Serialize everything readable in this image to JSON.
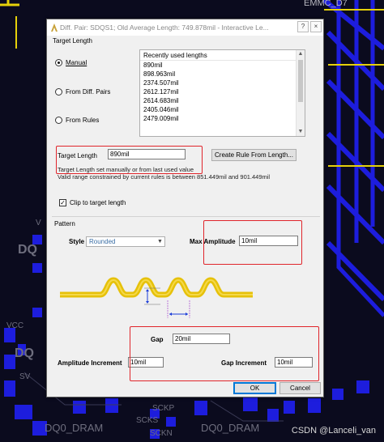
{
  "background": {
    "labels": {
      "top_right": "EMMC_D7",
      "dq_a": "DQ",
      "dq_b": "DQ",
      "dq_c": "DQ",
      "vcc": "VCC",
      "sv": "SV",
      "v": "V",
      "sckp": "SCKP",
      "scks": "SCKS",
      "sckn": "SCKN",
      "dram_left": "DQ0_DRAM",
      "dram_right": "DQ0_DRAM"
    },
    "watermark": "CSDN @Lanceli_van",
    "colors": {
      "board": "#0b0b1e",
      "copper": "#1d1ddd",
      "trace_yellow": "#e6d10a"
    }
  },
  "dialog": {
    "title": "Diff. Pair: SDQS1; Old Average Length: 749.878mil - Interactive Le...",
    "title_icon": "altium-app-icon",
    "window_buttons": {
      "help": "?",
      "close": "×"
    },
    "target_length_group": {
      "title": "Target Length",
      "mode_options": [
        {
          "label": "Manual",
          "selected": true
        },
        {
          "label": "From Diff. Pairs",
          "selected": false
        },
        {
          "label": "From Rules",
          "selected": false
        }
      ],
      "recent_lengths": {
        "header": "Recently used lengths",
        "items": [
          "890mil",
          "898.963mil",
          "2374.507mil",
          "2612.127mil",
          "2614.683mil",
          "2405.046mil",
          "2479.009mil"
        ]
      },
      "target_length_label": "Target Length",
      "target_length_value": "890mil",
      "create_rule_button": "Create Rule From Length...",
      "hint_set": "Target Length set manually or from last used value",
      "hint_range": "Valid range constrained by current rules is between 851.449mil and 901.449mil",
      "clip_checkbox": {
        "label": "Clip to target length",
        "checked": true
      }
    },
    "pattern_group": {
      "title": "Pattern",
      "style_label": "Style",
      "style_value": "Rounded",
      "max_amplitude_label": "Max Amplitude",
      "max_amplitude_value": "10mil",
      "gap_label": "Gap",
      "gap_value": "20mil",
      "amplitude_increment_label": "Amplitude Increment",
      "amplitude_increment_value": "10mil",
      "gap_increment_label": "Gap Increment",
      "gap_increment_value": "10mil"
    },
    "buttons": {
      "ok": "OK",
      "cancel": "Cancel"
    },
    "annotation_color": "#e0252b"
  }
}
